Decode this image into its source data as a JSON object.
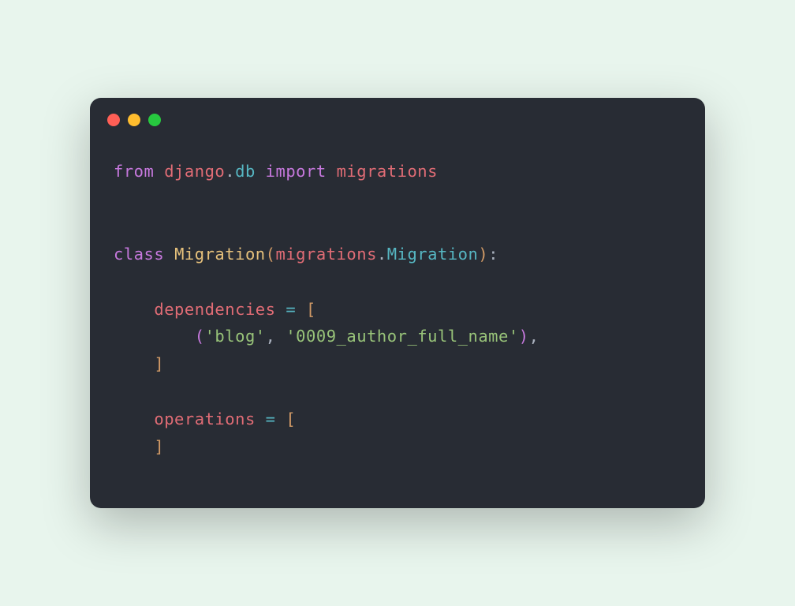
{
  "code": {
    "line1": {
      "from": "from",
      "django": "django",
      "dot1": ".",
      "db": "db",
      "import": "import",
      "migrations": "migrations"
    },
    "line3": {
      "class": "class",
      "Migration": "Migration",
      "paren_open": "(",
      "migrations": "migrations",
      "dot": ".",
      "MigrationBase": "Migration",
      "paren_close": ")",
      "colon": ":"
    },
    "line5": {
      "indent": "    ",
      "dependencies": "dependencies",
      "equals": " = ",
      "bracket_open": "["
    },
    "line6": {
      "indent": "        ",
      "paren_open": "(",
      "blog": "'blog'",
      "comma1": ", ",
      "migration_name": "'0009_author_full_name'",
      "paren_close": ")",
      "comma2": ","
    },
    "line7": {
      "indent": "    ",
      "bracket_close": "]"
    },
    "line9": {
      "indent": "    ",
      "operations": "operations",
      "equals": " = ",
      "bracket_open": "["
    },
    "line10": {
      "indent": "    ",
      "bracket_close": "]"
    }
  }
}
